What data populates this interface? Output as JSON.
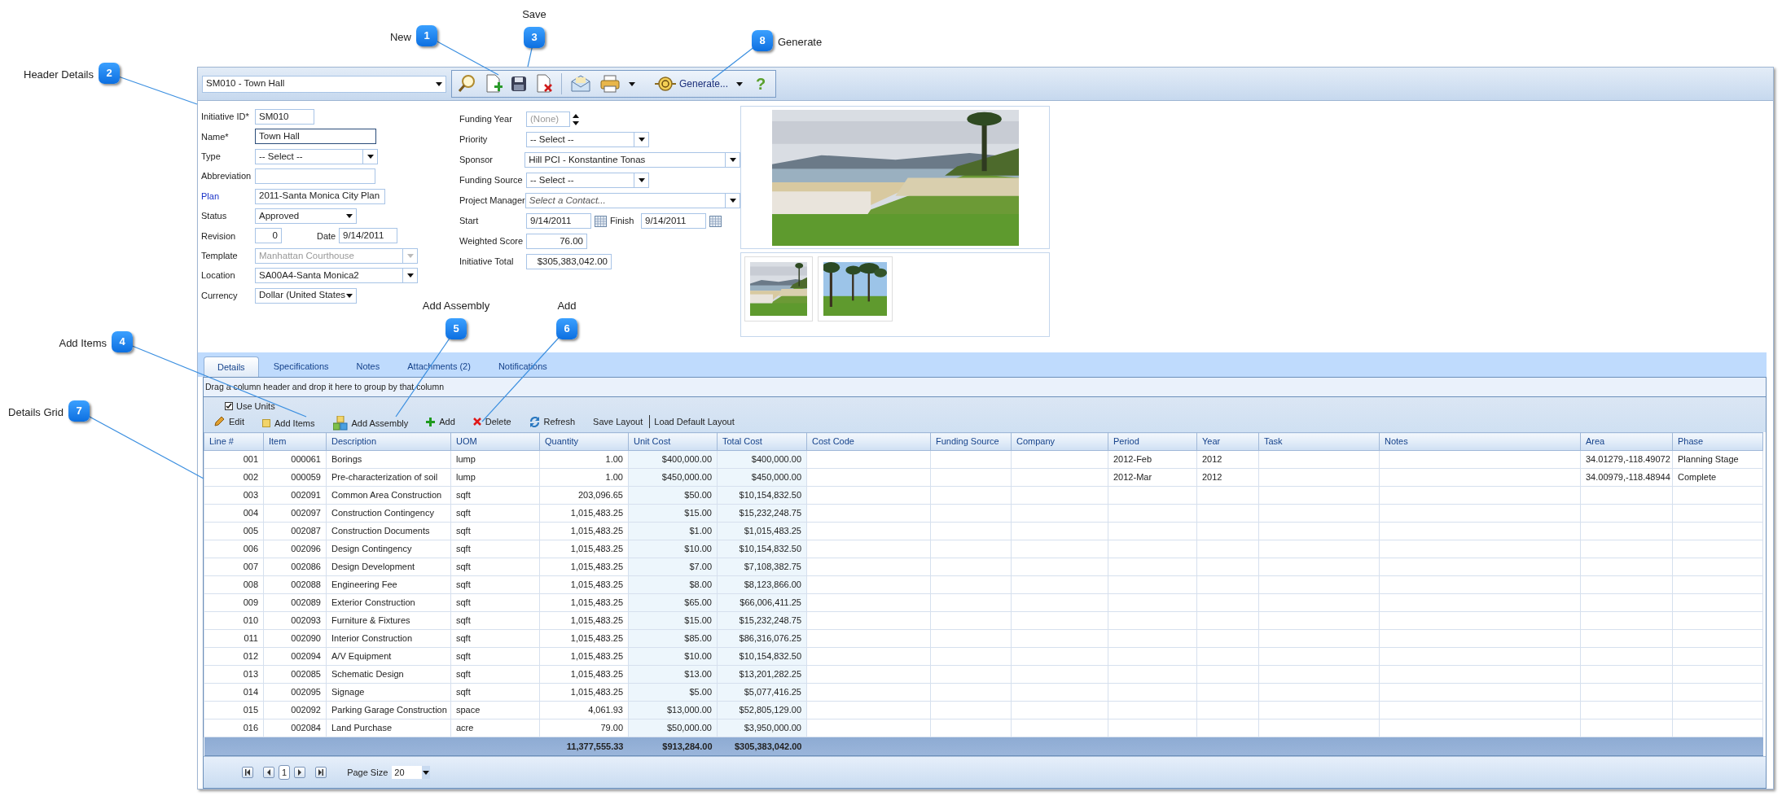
{
  "callouts": [
    {
      "number": "1",
      "label": "New"
    },
    {
      "number": "3",
      "label": "Save"
    },
    {
      "number": "8",
      "label": "Generate"
    },
    {
      "number": "2",
      "label": "Header Details"
    },
    {
      "number": "4",
      "label": "Add Items"
    },
    {
      "number": "5",
      "label": "Add Assembly"
    },
    {
      "number": "6",
      "label": "Add"
    },
    {
      "number": "7",
      "label": "Details Grid"
    }
  ],
  "record_selector": {
    "value": "SM010 - Town Hall"
  },
  "toolbar": {
    "generate_label": "Generate...",
    "help": "?"
  },
  "left_fields": [
    {
      "label": "Initiative ID*",
      "value": "SM010",
      "kind": "text",
      "focused": false,
      "disabled": false,
      "link": false
    },
    {
      "label": "Name*",
      "value": "Town Hall",
      "kind": "text",
      "focused": true,
      "disabled": false,
      "link": false
    },
    {
      "label": "Type",
      "value": "-- Select --",
      "kind": "combo",
      "focused": false,
      "disabled": false,
      "link": false
    },
    {
      "label": "Abbreviation",
      "kind": "text",
      "focused": false,
      "disabled": false,
      "link": false
    },
    {
      "label": "Plan",
      "value": "2011-Santa Monica City Plan",
      "kind": "text",
      "focused": false,
      "disabled": false,
      "link": true
    },
    {
      "label": "Status",
      "value": "Approved",
      "kind": "dropdown",
      "focused": false,
      "disabled": false,
      "link": false
    },
    {
      "label": "Revision",
      "value": "0",
      "kind": "pair",
      "second_label": "Date",
      "second_value": "9/14/2011",
      "focused": false,
      "disabled": false,
      "link": false
    },
    {
      "label": "Template",
      "value": "Manhattan Courthouse",
      "kind": "combo",
      "focused": false,
      "disabled": true,
      "link": false
    },
    {
      "label": "Location",
      "value": "SA00A4-Santa Monica2",
      "kind": "combo",
      "focused": false,
      "disabled": false,
      "link": false
    },
    {
      "label": "Currency",
      "value": "Dollar (United States",
      "kind": "dropdown",
      "focused": false,
      "disabled": false,
      "link": false
    }
  ],
  "middle_fields": [
    {
      "label": "Funding Year",
      "placeholder": "(None)",
      "kind": "spinner"
    },
    {
      "label": "Priority",
      "value": "-- Select --",
      "kind": "combo"
    },
    {
      "label": "Sponsor",
      "value": "Hill PCI - Konstantine Tonas",
      "kind": "combo"
    },
    {
      "label": "Funding Source",
      "value": "-- Select --",
      "kind": "combo"
    },
    {
      "label": "Project Manager",
      "placeholder": "Select a Contact...",
      "kind": "combo"
    },
    {
      "label": "Start",
      "value": "9/14/2011",
      "kind": "dates",
      "second_label": "Finish",
      "second_value": "9/14/2011"
    },
    {
      "label": "Weighted Score",
      "value": "76.00",
      "kind": "number"
    },
    {
      "label": "Initiative Total",
      "value": "$305,383,042.00",
      "kind": "number"
    }
  ],
  "tabs": [
    {
      "label": "Details",
      "selected": true
    },
    {
      "label": "Specifications",
      "selected": false
    },
    {
      "label": "Notes",
      "selected": false
    },
    {
      "label": "Attachments (2)",
      "selected": false
    },
    {
      "label": "Notifications",
      "selected": false
    }
  ],
  "group_hint": "Drag a column header and drop it here to group by that column",
  "use_units": {
    "label": "Use Units",
    "checked": true
  },
  "grid_actions": [
    {
      "label": "Edit",
      "kind": "edit"
    },
    {
      "label": "Add Items",
      "kind": "items"
    },
    {
      "label": "Add Assembly",
      "kind": "assembly"
    },
    {
      "label": "Add",
      "kind": "add"
    },
    {
      "label": "Delete",
      "kind": "delete"
    },
    {
      "label": "Refresh",
      "kind": "refresh"
    },
    {
      "label": "Save Layout",
      "kind": "plain"
    },
    {
      "label": "Load Default Layout",
      "kind": "separated"
    }
  ],
  "table": {
    "columns": [
      {
        "label": "Line #",
        "kind": "number"
      },
      {
        "label": "Item",
        "kind": "number"
      },
      {
        "label": "Description",
        "kind": "text"
      },
      {
        "label": "UOM",
        "kind": "text"
      },
      {
        "label": "Quantity",
        "kind": "number",
        "total": "11,377,555.33"
      },
      {
        "label": "Unit Cost",
        "kind": "computed",
        "total": "$913,284.00"
      },
      {
        "label": "Total Cost",
        "kind": "computed",
        "total": "$305,383,042.00"
      },
      {
        "label": "Cost Code",
        "kind": "text"
      },
      {
        "label": "Funding Source",
        "kind": "text"
      },
      {
        "label": "Company",
        "kind": "text"
      },
      {
        "label": "Period",
        "kind": "text"
      },
      {
        "label": "Year",
        "kind": "text"
      },
      {
        "label": "Task",
        "kind": "text"
      },
      {
        "label": "Notes",
        "kind": "text"
      },
      {
        "label": "Area",
        "kind": "text"
      },
      {
        "label": "Phase",
        "kind": "text"
      }
    ],
    "rows": [
      [
        "001",
        "000061",
        "Borings",
        "lump",
        "1.00",
        "$400,000.00",
        "$400,000.00",
        null,
        null,
        null,
        "2012-Feb",
        "2012",
        null,
        null,
        "34.01279,-118.49072",
        "Planning Stage"
      ],
      [
        "002",
        "000059",
        "Pre-characterization of soil",
        "lump",
        "1.00",
        "$450,000.00",
        "$450,000.00",
        null,
        null,
        null,
        "2012-Mar",
        "2012",
        null,
        null,
        "34.00979,-118.48944",
        "Complete"
      ],
      [
        "003",
        "002091",
        "Common Area Construction",
        "sqft",
        "203,096.65",
        "$50.00",
        "$10,154,832.50"
      ],
      [
        "004",
        "002097",
        "Construction Contingency",
        "sqft",
        "1,015,483.25",
        "$15.00",
        "$15,232,248.75"
      ],
      [
        "005",
        "002087",
        "Construction Documents",
        "sqft",
        "1,015,483.25",
        "$1.00",
        "$1,015,483.25"
      ],
      [
        "006",
        "002096",
        "Design Contingency",
        "sqft",
        "1,015,483.25",
        "$10.00",
        "$10,154,832.50"
      ],
      [
        "007",
        "002086",
        "Design Development",
        "sqft",
        "1,015,483.25",
        "$7.00",
        "$7,108,382.75"
      ],
      [
        "008",
        "002088",
        "Engineering Fee",
        "sqft",
        "1,015,483.25",
        "$8.00",
        "$8,123,866.00"
      ],
      [
        "009",
        "002089",
        "Exterior Construction",
        "sqft",
        "1,015,483.25",
        "$65.00",
        "$66,006,411.25"
      ],
      [
        "010",
        "002093",
        "Furniture & Fixtures",
        "sqft",
        "1,015,483.25",
        "$15.00",
        "$15,232,248.75"
      ],
      [
        "011",
        "002090",
        "Interior Construction",
        "sqft",
        "1,015,483.25",
        "$85.00",
        "$86,316,076.25"
      ],
      [
        "012",
        "002094",
        "A/V Equipment",
        "sqft",
        "1,015,483.25",
        "$10.00",
        "$10,154,832.50"
      ],
      [
        "013",
        "002085",
        "Schematic Design",
        "sqft",
        "1,015,483.25",
        "$13.00",
        "$13,201,282.25"
      ],
      [
        "014",
        "002095",
        "Signage",
        "sqft",
        "1,015,483.25",
        "$5.00",
        "$5,077,416.25"
      ],
      [
        "015",
        "002092",
        "Parking Garage Construction",
        "space",
        "4,061.93",
        "$13,000.00",
        "$52,805,129.00"
      ],
      [
        "016",
        "002084",
        "Land Purchase",
        "acre",
        "79.00",
        "$50,000.00",
        "$3,950,000.00"
      ]
    ]
  },
  "pager": {
    "page": "1",
    "page_size_label": "Page Size",
    "page_size": "20"
  }
}
